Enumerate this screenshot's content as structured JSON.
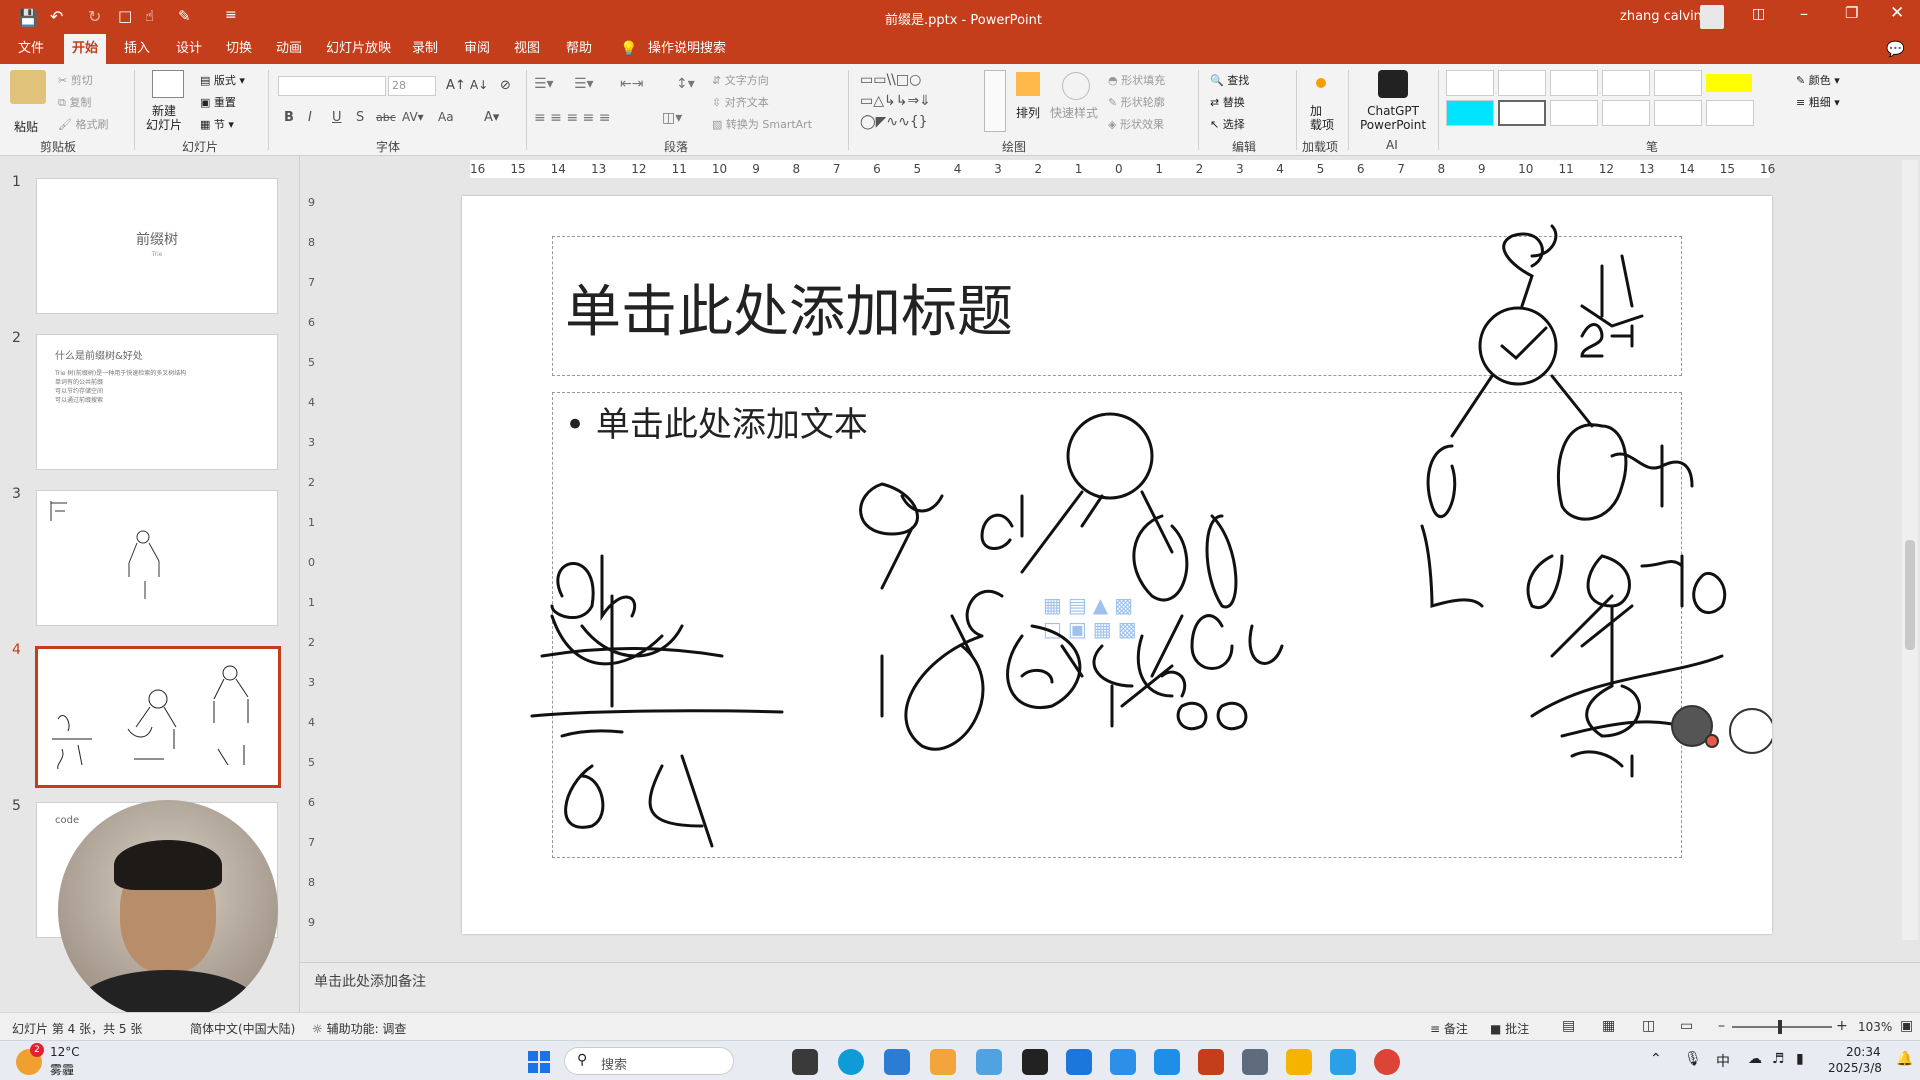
{
  "titlebar": {
    "title": "前缀是.pptx  -  PowerPoint",
    "user": "zhang calvin"
  },
  "tabs": [
    "文件",
    "开始",
    "插入",
    "设计",
    "切换",
    "动画",
    "幻灯片放映",
    "录制",
    "审阅",
    "视图",
    "帮助",
    "操作说明搜索"
  ],
  "active_tab": "开始",
  "ribbon": {
    "clipboard": {
      "paste": "粘贴",
      "cut": "剪切",
      "copy": "复制",
      "format_painter": "格式刷",
      "label": "剪贴板"
    },
    "slides": {
      "new_slide": "新建\n幻灯片",
      "layout": "版式",
      "reset": "重置",
      "section": "节",
      "label": "幻灯片"
    },
    "font": {
      "size": "28",
      "label": "字体",
      "bold": "B",
      "italic": "I",
      "underline": "U",
      "strike": "S",
      "abc": "abc",
      "aa": "Aa"
    },
    "paragraph": {
      "label": "段落",
      "text_direction": "文字方向",
      "align_text": "对齐文本",
      "smartart": "转换为 SmartArt"
    },
    "drawing": {
      "arrange": "排列",
      "quick_styles": "快速样式",
      "fill": "形状填充",
      "outline": "形状轮廓",
      "effects": "形状效果",
      "label": "绘图"
    },
    "editing": {
      "find": "查找",
      "replace": "替换",
      "select": "选择",
      "label": "编辑"
    },
    "addins": {
      "btn": "加\n载项",
      "label": "加载项"
    },
    "ai": {
      "btn": "ChatGPT\nPowerPoint",
      "label": "AI"
    },
    "pens": {
      "label": "笔",
      "color": "颜色",
      "thickness": "粗细"
    }
  },
  "slides_panel": [
    {
      "num": "1",
      "title": "前缀树",
      "subtitle": "Trie"
    },
    {
      "num": "2",
      "title": "什么是前缀树&好处",
      "bullets": [
        "Trie 树(前缀树)是一种用于快速检索的多叉树结构",
        "单词有的公共前缀",
        "可以节约存储空间",
        "可以通过前缀搜索"
      ]
    },
    {
      "num": "3"
    },
    {
      "num": "4"
    },
    {
      "num": "5",
      "title": "code"
    }
  ],
  "ruler_h": [
    "16",
    "15",
    "14",
    "13",
    "12",
    "11",
    "10",
    "9",
    "8",
    "7",
    "6",
    "5",
    "4",
    "3",
    "2",
    "1",
    "0",
    "1",
    "2",
    "3",
    "4",
    "5",
    "6",
    "7",
    "8",
    "9",
    "10",
    "11",
    "12",
    "13",
    "14",
    "15",
    "16"
  ],
  "ruler_v": [
    "9",
    "8",
    "7",
    "6",
    "5",
    "4",
    "3",
    "2",
    "1",
    "0",
    "1",
    "2",
    "3",
    "4",
    "5",
    "6",
    "7",
    "8",
    "9"
  ],
  "slide": {
    "title_placeholder": "单击此处添加标题",
    "body_placeholder": "单击此处添加文本"
  },
  "notes_placeholder": "单击此处添加备注",
  "status": {
    "slide_info": "幻灯片 第 4 张，共 5 张",
    "language": "简体中文(中国大陆)",
    "accessibility": "辅助功能: 调查",
    "notes": "备注",
    "comments": "批注",
    "zoom": "103%"
  },
  "taskbar": {
    "weather_temp": "12°C",
    "weather_desc": "雾霾",
    "weather_badge": "2",
    "search": "搜索",
    "time": "20:34",
    "date": "2025/3/8"
  },
  "colors": {
    "accent": "#c43e1c"
  }
}
